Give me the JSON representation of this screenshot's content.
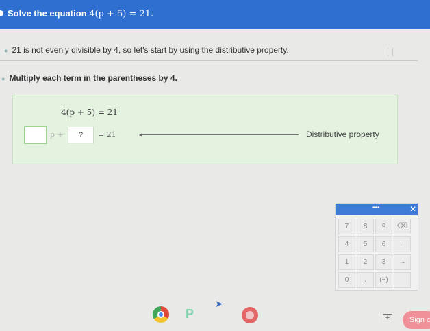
{
  "banner": {
    "prefix": "Solve the equation ",
    "equation": "4(p + 5) = 21."
  },
  "steps": [
    {
      "text": "21 is not evenly divisible by 4, so let's start by using the distributive property."
    },
    {
      "text": "Multiply each term in the parentheses by 4."
    }
  ],
  "panel": {
    "equation_top": "4(p + 5) = 21",
    "p_plus": "p +",
    "blank_placeholder": "?",
    "equals_21": "= 21",
    "reason": "Distributive property"
  },
  "keypad": {
    "header_dots": "•••",
    "close": "✕",
    "rows": [
      [
        "7",
        "8",
        "9",
        "⌫"
      ],
      [
        "4",
        "5",
        "6",
        "←"
      ],
      [
        "1",
        "2",
        "3",
        "→"
      ],
      [
        "0",
        ".",
        "(−)",
        ""
      ]
    ]
  },
  "taskbar": {
    "sign_in": "Sign c"
  },
  "colors": {
    "banner": "#2f6fd0",
    "panel": "#e4f2e0",
    "input_border": "#9fcf92",
    "keypad_header": "#3e7bd8",
    "sign_in": "#f09098"
  }
}
